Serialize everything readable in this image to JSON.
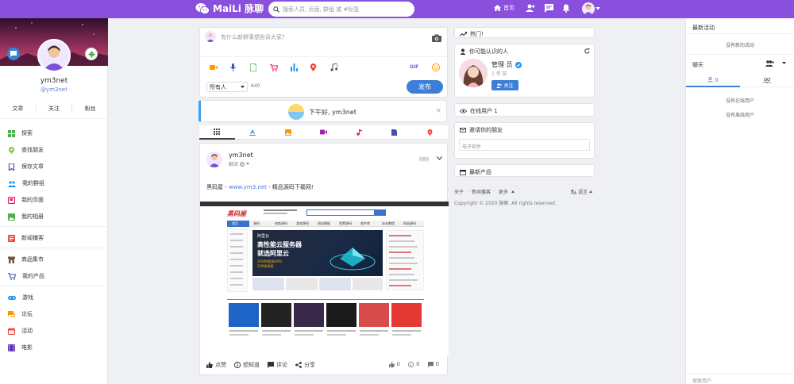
{
  "topbar": {
    "logo_text": "MaiLi 脉聊",
    "search_placeholder": "搜索人员, 页面, 群组 或 #标签",
    "home_label": "首页",
    "icons": [
      "wechat-icon",
      "search-icon",
      "home-icon",
      "add-user-icon",
      "chat-icon",
      "bell-icon",
      "avatar",
      "chevron-down-icon"
    ]
  },
  "profile": {
    "name": "ym3net",
    "handle": "@ym3net",
    "tabs": [
      "文章",
      "关注",
      "粉丝"
    ]
  },
  "menu": {
    "group1": [
      "探索",
      "查找朋友",
      "保存文章",
      "我的群组",
      "我的页面",
      "我的相册"
    ],
    "group2": [
      "新闻播客"
    ],
    "group3": [
      "商品集市",
      "我的产品"
    ],
    "group4": [
      "游戏",
      "论坛",
      "活动",
      "电影"
    ]
  },
  "composer": {
    "placeholder": "有什么新鲜事想告诉大家?",
    "gif_label": "GIF",
    "privacy": "所有人",
    "count": "640",
    "post_label": "发布"
  },
  "greeting": {
    "text": "下午好, ym3net"
  },
  "post": {
    "author": "ym3net",
    "meta": "翻译",
    "time": "刚刚",
    "text_prefix": "黑码屋 - ",
    "text_link": "www.ym3.net",
    "text_suffix": " - 精品源码下载网!",
    "actions": [
      "点赞",
      "想知道",
      "评论",
      "分享"
    ],
    "stats": {
      "likes": "0",
      "views": "0",
      "comments": "0"
    }
  },
  "screenshot": {
    "logo": "黑码屋",
    "banner_title": "高性能云服务器",
    "banner_sub": "就选阿里云",
    "banner_brand": "阿里云",
    "banner_line1": "2000M超高IOPS",
    "banner_line2": "25M高带宽",
    "nav": [
      "首页",
      "源码",
      "电商源码",
      "游戏源码",
      "网站模板",
      "免费源码",
      "软件库",
      "站长教程",
      "网站源码"
    ]
  },
  "widgets": {
    "trending": "热门!",
    "may_know": "你可能认识的人",
    "suggest_name": "管理 员",
    "suggest_time": "1 年 前",
    "follow_label": "关注",
    "online": "在线用户 1",
    "invite": "邀请你的朋友",
    "invite_placeholder": "电子邮件",
    "products": "最新产品",
    "footer_links": [
      "关于",
      "新闻播客",
      "更多"
    ],
    "language": "语言",
    "copyright": "Copyright © 2020 脉聊. All rights reserved."
  },
  "activity": {
    "title": "最新活动",
    "empty": "没有新的活动",
    "chat_title": "聊天",
    "online_count": "0",
    "no_online": "没有在线用户",
    "no_offline": "没有离线用户",
    "search_placeholder": "搜索用户"
  },
  "colors": {
    "brand": "#8a4fdc",
    "accent": "#3d7fd6",
    "link": "#5b7fd6"
  }
}
